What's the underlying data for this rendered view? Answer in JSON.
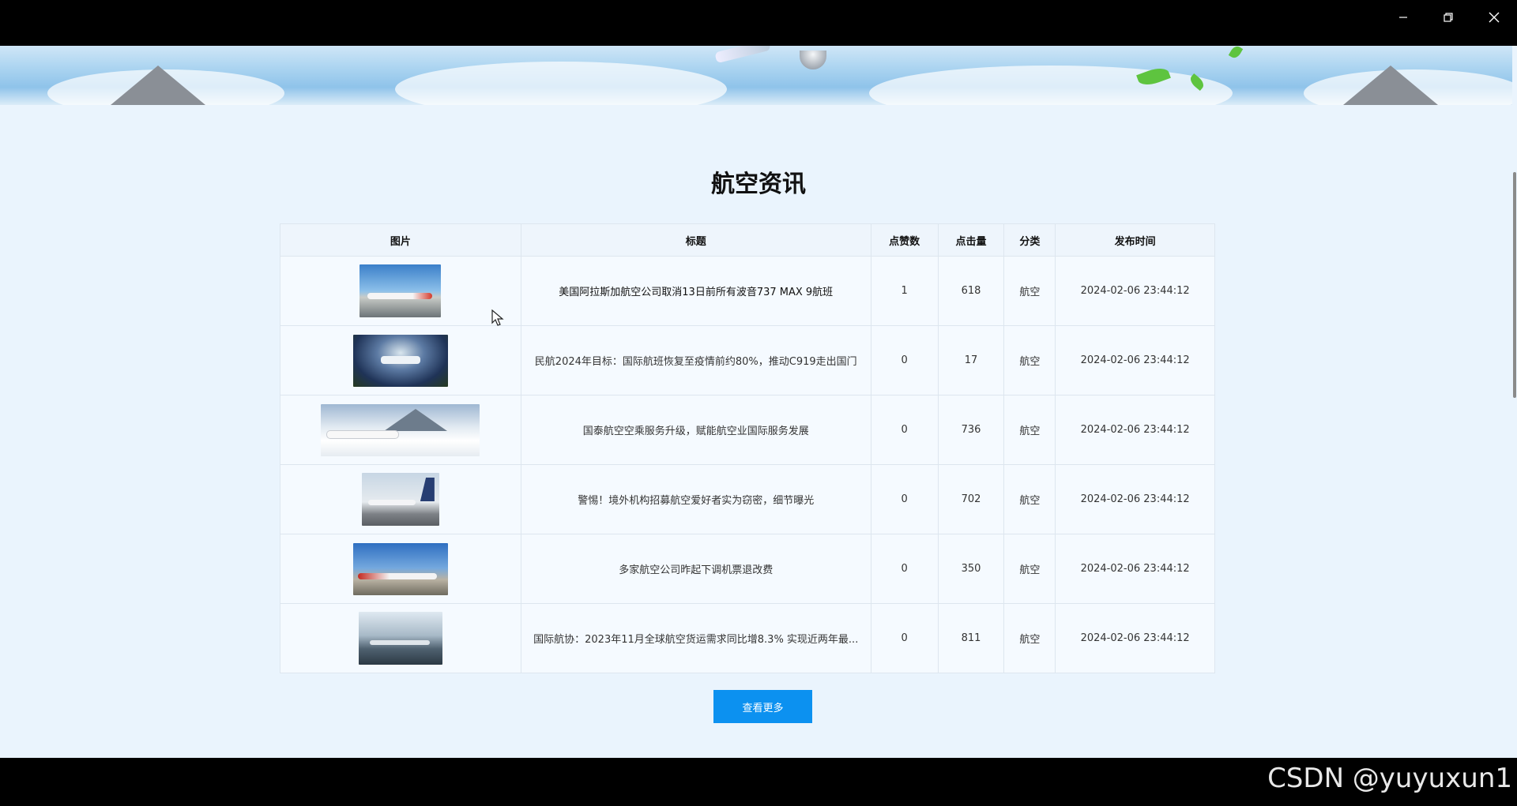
{
  "window_controls": {
    "minimize_icon": "minimize-icon",
    "restore_icon": "restore-icon",
    "close_icon": "close-icon"
  },
  "section": {
    "title": "航空资讯"
  },
  "table": {
    "headers": [
      "图片",
      "标题",
      "点赞数",
      "点击量",
      "分类",
      "发布时间"
    ],
    "rows": [
      {
        "title": "美国阿拉斯加航空公司取消13日前所有波音737 MAX 9航班",
        "likes": "1",
        "clicks": "618",
        "category": "航空",
        "time": "2024-02-06 23:44:12"
      },
      {
        "title": "民航2024年目标：国际航班恢复至疫情前约80%，推动C919走出国门",
        "likes": "0",
        "clicks": "17",
        "category": "航空",
        "time": "2024-02-06 23:44:12"
      },
      {
        "title": "国泰航空空乘服务升级，赋能航空业国际服务发展",
        "likes": "0",
        "clicks": "736",
        "category": "航空",
        "time": "2024-02-06 23:44:12"
      },
      {
        "title": "警惕！境外机构招募航空爱好者实为窃密，细节曝光",
        "likes": "0",
        "clicks": "702",
        "category": "航空",
        "time": "2024-02-06 23:44:12"
      },
      {
        "title": "多家航空公司昨起下调机票退改费",
        "likes": "0",
        "clicks": "350",
        "category": "航空",
        "time": "2024-02-06 23:44:12"
      },
      {
        "title": "国际航协：2023年11月全球航空货运需求同比增8.3% 实现近两年最...",
        "likes": "0",
        "clicks": "811",
        "category": "航空",
        "time": "2024-02-06 23:44:12"
      }
    ]
  },
  "more_button": {
    "label": "查看更多"
  },
  "watermark": {
    "text": "CSDN @yuyuxun1"
  },
  "colors": {
    "page_bg": "#eaf4fd",
    "accent": "#0c91f0",
    "table_bg": "#f5faff"
  }
}
